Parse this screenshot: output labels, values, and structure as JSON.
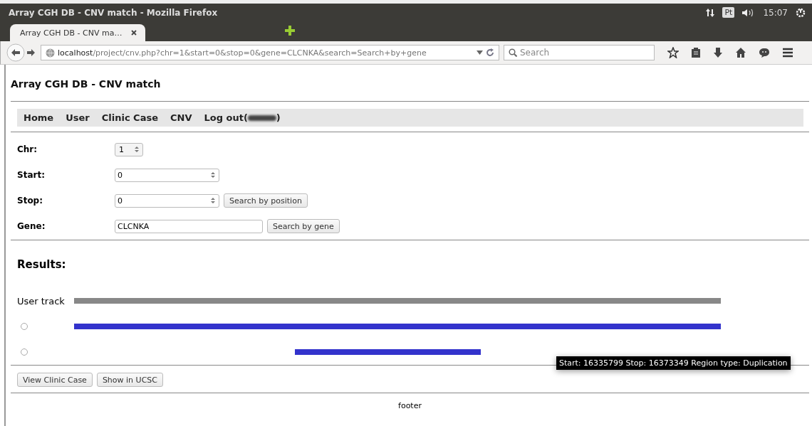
{
  "window": {
    "title": "Array CGH DB - CNV match - Mozilla Firefox"
  },
  "tray": {
    "keyboard": "Pt",
    "time": "15:07"
  },
  "tabs": [
    {
      "label": "Array CGH DB - CNV ma…",
      "selected": true
    }
  ],
  "address": {
    "host": "localhost",
    "path": "/project/cnv.php?chr=1&start=0&stop=0&gene=CLCNKA&search=Search+by+gene"
  },
  "search": {
    "placeholder": "Search"
  },
  "page": {
    "heading": "Array CGH DB - CNV match",
    "nav": [
      {
        "label": "Home"
      },
      {
        "label": "User"
      },
      {
        "label": "Clinic Case"
      },
      {
        "label": "CNV"
      },
      {
        "label": "Log out(",
        "suffix": ")",
        "redacted": true
      }
    ],
    "form": [
      {
        "kind": "select",
        "label": "Chr:",
        "value": "1"
      },
      {
        "kind": "number",
        "label": "Start:",
        "value": "0"
      },
      {
        "kind": "number",
        "label": "Stop:",
        "value": "0",
        "button": "Search by position"
      },
      {
        "kind": "text",
        "label": "Gene:",
        "value": "CLCNKA",
        "button": "Search by gene"
      }
    ],
    "results_heading": "Results:",
    "tracks": [
      {
        "kind": "label",
        "label": "User track",
        "color": "#888888"
      },
      {
        "kind": "radio",
        "selected": false,
        "color": "#3333cc"
      },
      {
        "kind": "radio",
        "selected": false,
        "color": "#3333cc"
      }
    ],
    "tooltip": "Start: 16335799 Stop: 16373349 Region type: Duplication",
    "buttons": [
      "View Clinic Case",
      "Show in UCSC"
    ],
    "footer": "footer"
  }
}
